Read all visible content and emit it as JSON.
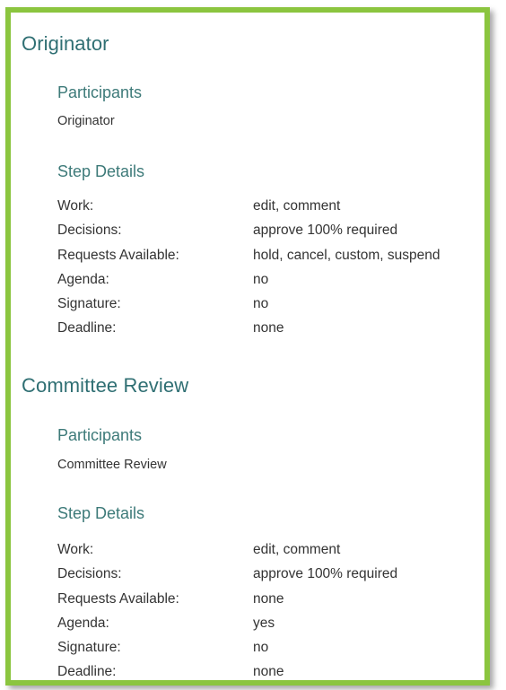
{
  "sections": [
    {
      "title": "Originator",
      "participants_heading": "Participants",
      "participants": "Originator",
      "details_heading": "Step Details",
      "details": [
        {
          "label": "Work:",
          "value": "edit, comment"
        },
        {
          "label": "Decisions:",
          "value": "approve 100% required"
        },
        {
          "label": "Requests Available:",
          "value": "hold, cancel, custom, suspend"
        },
        {
          "label": "Agenda:",
          "value": "no"
        },
        {
          "label": "Signature:",
          "value": "no"
        },
        {
          "label": "Deadline:",
          "value": "none"
        }
      ]
    },
    {
      "title": "Committee Review",
      "participants_heading": "Participants",
      "participants": "Committee Review",
      "details_heading": "Step Details",
      "details": [
        {
          "label": "Work:",
          "value": "edit, comment"
        },
        {
          "label": "Decisions:",
          "value": "approve 100% required"
        },
        {
          "label": "Requests Available:",
          "value": "none"
        },
        {
          "label": "Agenda:",
          "value": "yes"
        },
        {
          "label": "Signature:",
          "value": "no"
        },
        {
          "label": "Deadline:",
          "value": "none"
        }
      ]
    }
  ],
  "colors": {
    "border": "#8bc53f",
    "heading": "#2f6f73",
    "text": "#333333"
  }
}
